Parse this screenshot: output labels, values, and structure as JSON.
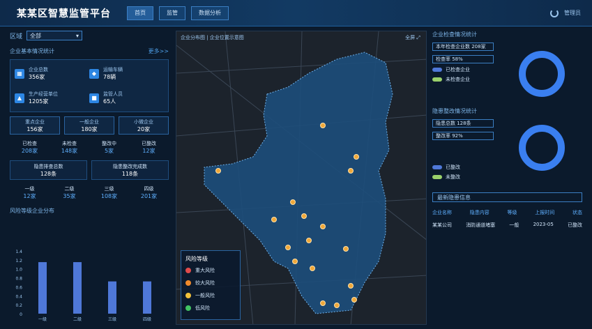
{
  "header": {
    "title": "某某区智慧监管平台",
    "tabs": [
      "首页",
      "监管",
      "数据分析"
    ],
    "user": "管理员"
  },
  "left": {
    "area_label": "区域",
    "area_value": "全部",
    "overview_title": "企业基本情况统计",
    "overview_more": "更多>>",
    "stats": [
      {
        "icon": "building-icon",
        "label": "企业总数",
        "value": "356家"
      },
      {
        "icon": "truck-icon",
        "label": "运输车辆",
        "value": "78辆"
      },
      {
        "icon": "factory-icon",
        "label": "生产经营单位",
        "value": "1205家"
      },
      {
        "icon": "shield-icon",
        "label": "监管人员",
        "value": "65人"
      }
    ],
    "tri": [
      {
        "k": "重点企业",
        "v": "156家"
      },
      {
        "k": "一般企业",
        "v": "180家"
      },
      {
        "k": "小微企业",
        "v": "20家"
      }
    ],
    "quad": [
      {
        "k": "已检查",
        "v": "208家"
      },
      {
        "k": "未检查",
        "v": "148家"
      },
      {
        "k": "整改中",
        "v": "5家"
      },
      {
        "k": "已整改",
        "v": "12家"
      }
    ],
    "duo": [
      {
        "k": "隐患排查总数",
        "v": "128条"
      },
      {
        "k": "隐患整改完成数",
        "v": "118条"
      }
    ],
    "quad2": [
      {
        "k": "一级",
        "v": "12家"
      },
      {
        "k": "二级",
        "v": "35家"
      },
      {
        "k": "三级",
        "v": "108家"
      },
      {
        "k": "四级",
        "v": "201家"
      }
    ],
    "chart_title": "风险等级企业分布"
  },
  "chart_data": {
    "type": "bar",
    "categories": [
      "一级",
      "二级",
      "三级",
      "四级"
    ],
    "values": [
      1.15,
      1.15,
      0.72,
      0.72
    ],
    "ylim": [
      0,
      1.4
    ],
    "yticks": [
      "0",
      "0.2",
      "0.4",
      "0.6",
      "0.8",
      "1.0",
      "1.2",
      "1.4"
    ],
    "color": "#4f78d8"
  },
  "map": {
    "title": "企业分布图 | 企业位置示意图",
    "zoom": "全屏 ⤢",
    "legend_title": "风险等级",
    "legend": [
      {
        "label": "重大风险",
        "color": "#e04b4b"
      },
      {
        "label": "较大风险",
        "color": "#f08a2b"
      },
      {
        "label": "一般风险",
        "color": "#f2c13b"
      },
      {
        "label": "低风险",
        "color": "#41c463"
      }
    ]
  },
  "right": {
    "block1_title": "企业检查情况统计",
    "block1_chip": "本年检查企业数 208家",
    "block1_chip2": "检查率 58%",
    "block1_leg": [
      {
        "label": "已检查企业",
        "color": "#4f78d8"
      },
      {
        "label": "未检查企业",
        "color": "#9ad06b"
      }
    ],
    "block2_title": "隐患整改情况统计",
    "block2_chip": "隐患总数 128条",
    "block2_chip2": "整改率 92%",
    "block2_leg": [
      {
        "label": "已整改",
        "color": "#4f78d8"
      },
      {
        "label": "未整改",
        "color": "#9ad06b"
      }
    ],
    "table_title": "最新隐患信息",
    "table_head": [
      "企业名称",
      "隐患内容",
      "等级",
      "上报时间",
      "状态"
    ],
    "table_row": [
      "某某公司",
      "消防通道堵塞",
      "一般",
      "2023-05",
      "已整改"
    ]
  }
}
